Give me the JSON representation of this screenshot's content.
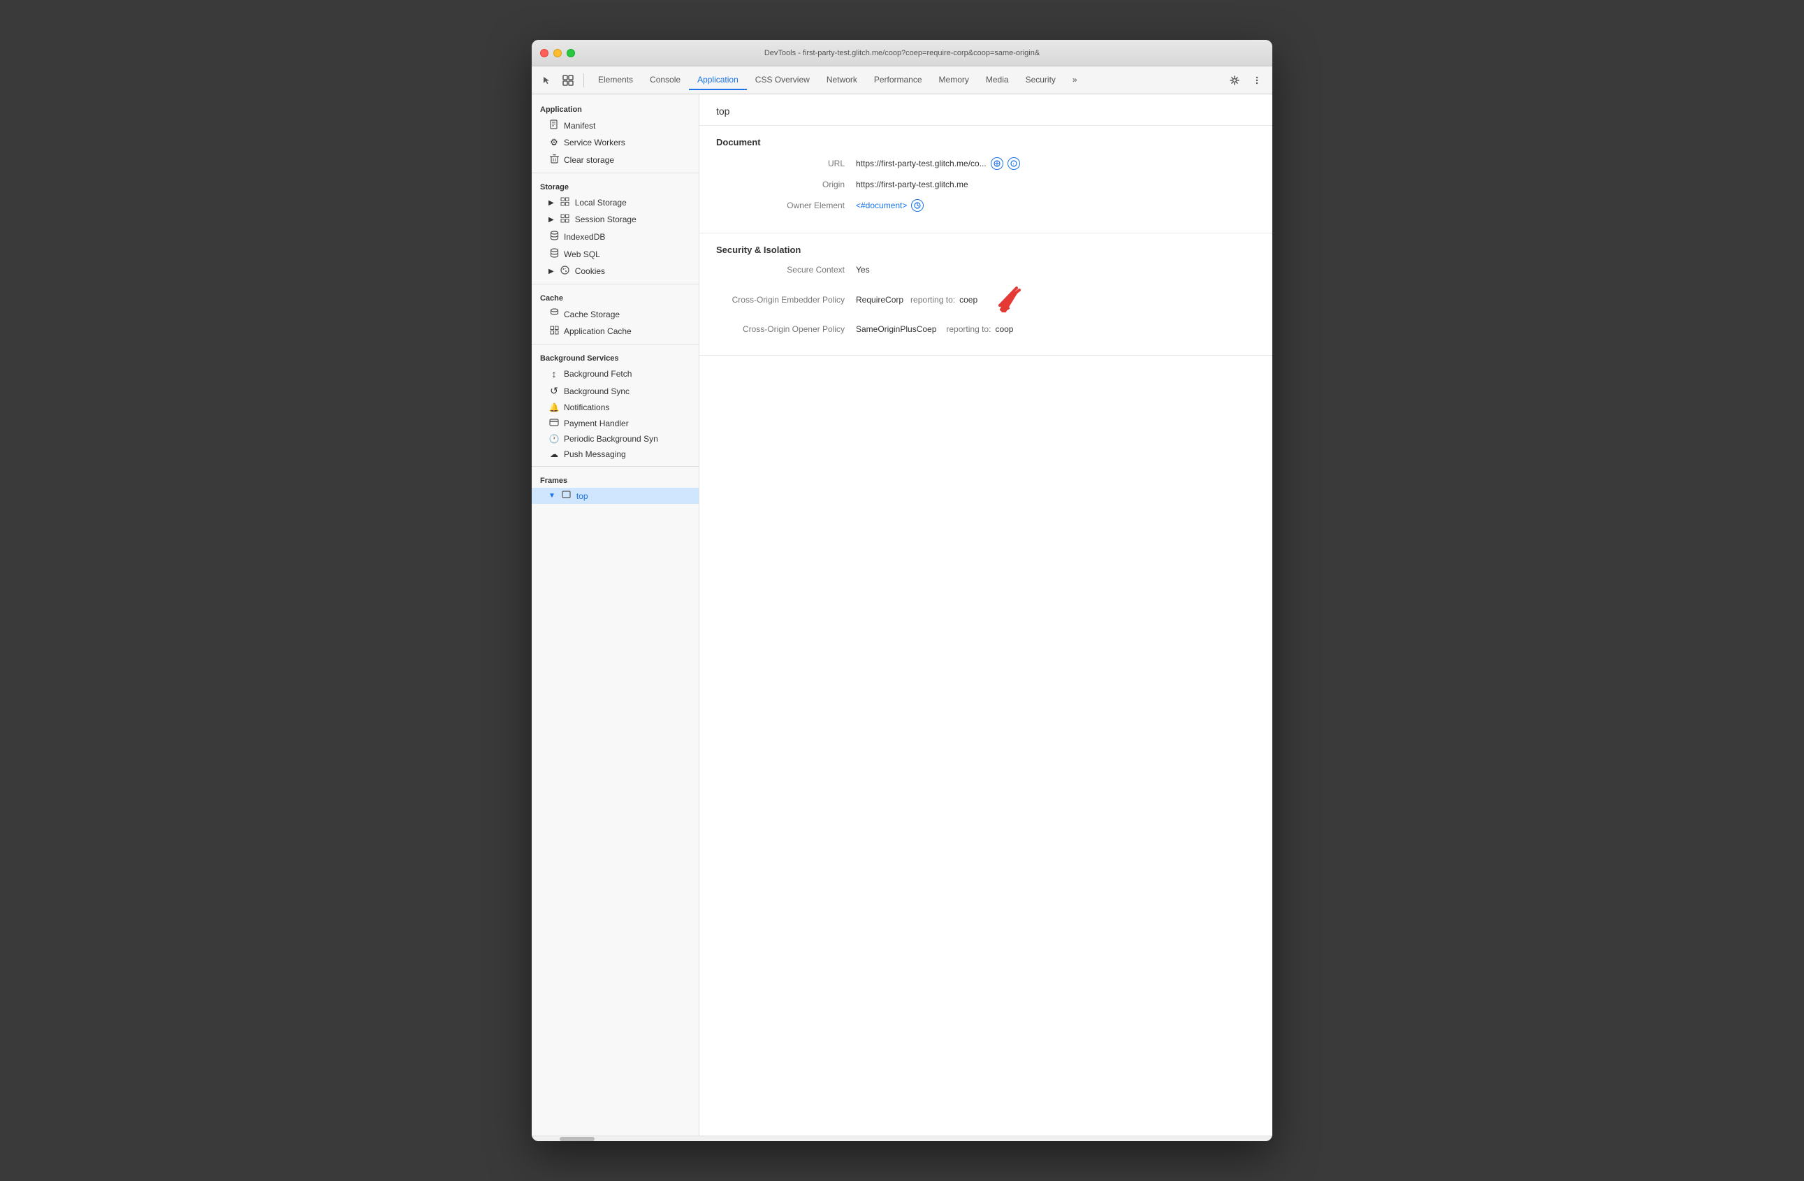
{
  "window": {
    "title": "DevTools - first-party-test.glitch.me/coop?coep=require-corp&coop=same-origin&"
  },
  "toolbar": {
    "tabs": [
      {
        "id": "elements",
        "label": "Elements",
        "active": false
      },
      {
        "id": "console",
        "label": "Console",
        "active": false
      },
      {
        "id": "application",
        "label": "Application",
        "active": true
      },
      {
        "id": "css-overview",
        "label": "CSS Overview",
        "active": false
      },
      {
        "id": "network",
        "label": "Network",
        "active": false
      },
      {
        "id": "performance",
        "label": "Performance",
        "active": false
      },
      {
        "id": "memory",
        "label": "Memory",
        "active": false
      },
      {
        "id": "media",
        "label": "Media",
        "active": false
      },
      {
        "id": "security",
        "label": "Security",
        "active": false
      }
    ]
  },
  "sidebar": {
    "sections": [
      {
        "id": "application",
        "header": "Application",
        "items": [
          {
            "id": "manifest",
            "label": "Manifest",
            "icon": "📄",
            "indent": 1
          },
          {
            "id": "service-workers",
            "label": "Service Workers",
            "icon": "⚙",
            "indent": 1
          },
          {
            "id": "clear-storage",
            "label": "Clear storage",
            "icon": "🗑",
            "indent": 1
          }
        ]
      },
      {
        "id": "storage",
        "header": "Storage",
        "items": [
          {
            "id": "local-storage",
            "label": "Local Storage",
            "icon": "▶",
            "hasGrid": true,
            "indent": 1
          },
          {
            "id": "session-storage",
            "label": "Session Storage",
            "icon": "▶",
            "hasGrid": true,
            "indent": 1
          },
          {
            "id": "indexeddb",
            "label": "IndexedDB",
            "icon": "",
            "hasGrid": false,
            "indent": 1
          },
          {
            "id": "web-sql",
            "label": "Web SQL",
            "icon": "",
            "hasGrid": false,
            "indent": 1
          },
          {
            "id": "cookies",
            "label": "Cookies",
            "icon": "▶",
            "hasCookie": true,
            "indent": 1
          }
        ]
      },
      {
        "id": "cache",
        "header": "Cache",
        "items": [
          {
            "id": "cache-storage",
            "label": "Cache Storage",
            "icon": "",
            "indent": 1
          },
          {
            "id": "application-cache",
            "label": "Application Cache",
            "icon": "",
            "indent": 1
          }
        ]
      },
      {
        "id": "background-services",
        "header": "Background Services",
        "items": [
          {
            "id": "background-fetch",
            "label": "Background Fetch",
            "icon": "↕",
            "indent": 1
          },
          {
            "id": "background-sync",
            "label": "Background Sync",
            "icon": "↺",
            "indent": 1
          },
          {
            "id": "notifications",
            "label": "Notifications",
            "icon": "🔔",
            "indent": 1
          },
          {
            "id": "payment-handler",
            "label": "Payment Handler",
            "icon": "💳",
            "indent": 1
          },
          {
            "id": "periodic-bg-sync",
            "label": "Periodic Background Syn",
            "icon": "🕐",
            "indent": 1
          },
          {
            "id": "push-messaging",
            "label": "Push Messaging",
            "icon": "☁",
            "indent": 1
          }
        ]
      },
      {
        "id": "frames",
        "header": "Frames",
        "items": [
          {
            "id": "top-frame",
            "label": "top",
            "icon": "▼",
            "hasFolder": true,
            "indent": 1,
            "selected": true
          }
        ]
      }
    ]
  },
  "content": {
    "breadcrumb": "top",
    "document_section": {
      "title": "Document",
      "fields": [
        {
          "label": "URL",
          "value": "https://first-party-test.glitch.me/co...",
          "hasIcons": true
        },
        {
          "label": "Origin",
          "value": "https://first-party-test.glitch.me"
        },
        {
          "label": "Owner Element",
          "value": "<#document>",
          "isLink": true,
          "hasCircleIcon": true
        }
      ]
    },
    "security_section": {
      "title": "Security & Isolation",
      "fields": [
        {
          "label": "Secure Context",
          "value": "Yes"
        },
        {
          "label": "Cross-Origin Embedder Policy",
          "value": "RequireCorp",
          "reporting_label": "reporting to:",
          "reporting_value": "coep",
          "has_arrow": true
        },
        {
          "label": "Cross-Origin Opener Policy",
          "value": "SameOriginPlusCoep",
          "reporting_label": "reporting to:",
          "reporting_value": "coop"
        }
      ]
    }
  }
}
